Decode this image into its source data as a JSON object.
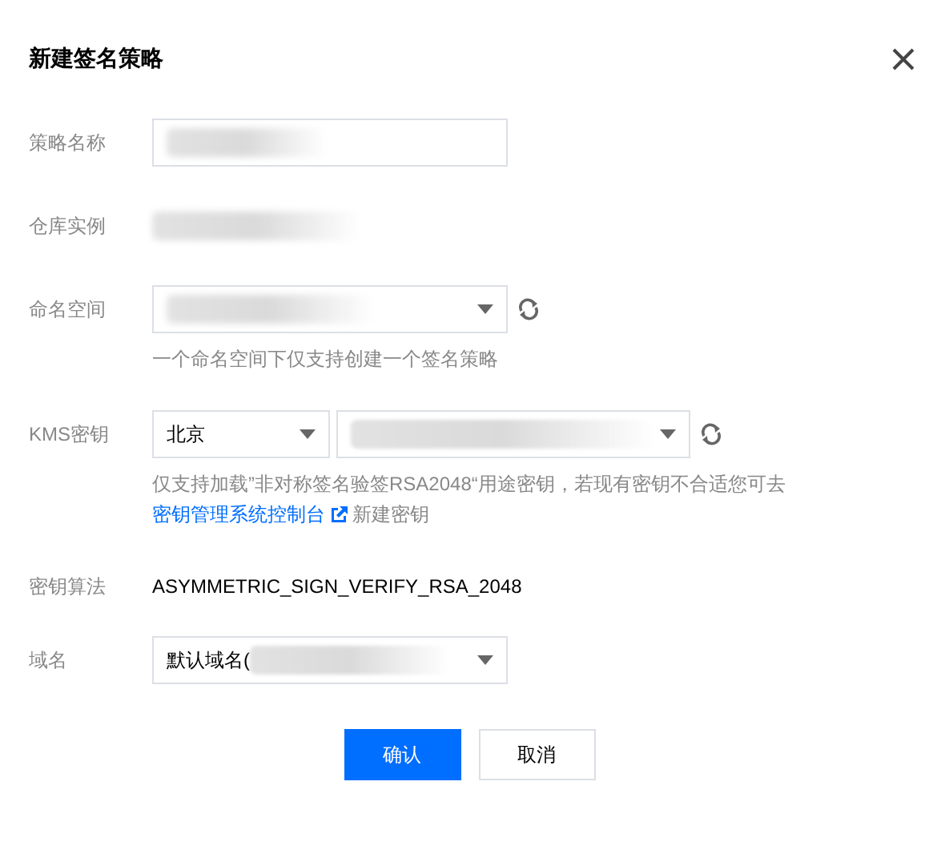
{
  "dialog": {
    "title": "新建签名策略"
  },
  "fields": [
    {
      "kind": "input",
      "label": "策略名称"
    },
    {
      "kind": "hidden",
      "label": "仓库实例"
    },
    {
      "kind": "select",
      "label": "命名空间",
      "refresh": true,
      "hint": "一个命名空间下仅支持创建一个签名策略"
    },
    {
      "kind": "kms",
      "label": "KMS密钥",
      "region": "北京",
      "refresh": true,
      "hint": "仅支持加载”非对称签名验签RSA2048“用途密钥，若现有密钥不合适您可去",
      "link": "密钥管理系统控制台",
      "link_suffix": "新建密钥"
    },
    {
      "kind": "text",
      "label": "密钥算法",
      "value": "ASYMMETRIC_SIGN_VERIFY_RSA_2048"
    },
    {
      "kind": "select",
      "label": "域名",
      "prefix": "默认域名(",
      "refresh": false
    }
  ],
  "buttons": [
    {
      "label": "确认",
      "kind": "primary"
    },
    {
      "label": "取消",
      "kind": "secondary"
    }
  ]
}
